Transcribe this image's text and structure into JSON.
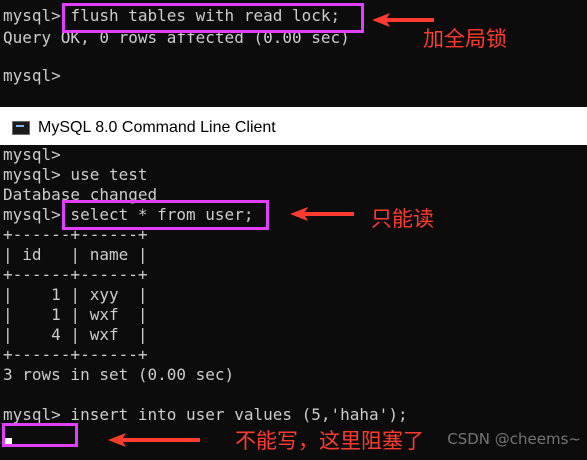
{
  "top_terminal": {
    "lines": [
      "mysql> flush tables with read lock;",
      "Query OK, 0 rows affected (0.00 sec)",
      "",
      "mysql>"
    ]
  },
  "window": {
    "title": "MySQL 8.0 Command Line Client",
    "icon": "mysql-console-icon"
  },
  "bottom_terminal": {
    "lines": [
      "mysql>",
      "mysql> use test",
      "Database changed",
      "mysql> select * from user;",
      "+------+------+",
      "| id   | name |",
      "+------+------+",
      "|    1 | xyy  |",
      "|    1 | wxf  |",
      "|    4 | wxf  |",
      "+------+------+",
      "3 rows in set (0.00 sec)",
      "",
      "mysql> insert into user values (5,'haha');"
    ]
  },
  "annotations": {
    "global_lock": "加全局锁",
    "read_only": "只能读",
    "blocked": "不能写，这里阻塞了"
  },
  "colors": {
    "highlight": "#e040fb",
    "annotation": "#ff3b30",
    "terminal_bg": "#0c0c0c",
    "terminal_text": "#cccccc"
  },
  "watermark": "CSDN @cheems~"
}
